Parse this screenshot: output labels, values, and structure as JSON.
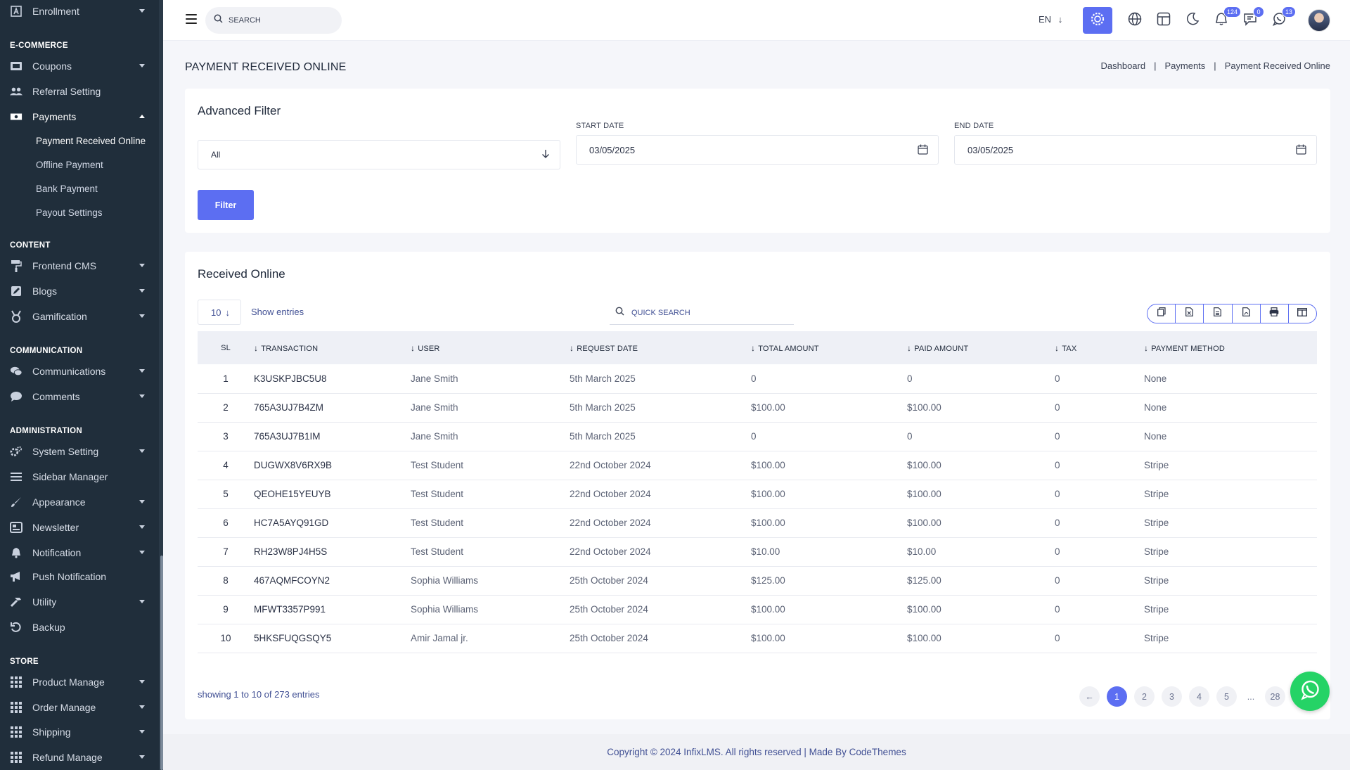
{
  "sidebar": {
    "items": [
      {
        "label": "Enrollment",
        "icon": "enrollment-icon"
      },
      {
        "label": "Coupons",
        "icon": "coupon-icon"
      },
      {
        "label": "Referral Setting",
        "icon": "users-icon"
      },
      {
        "label": "Payments",
        "icon": "money-icon"
      },
      {
        "label": "Frontend CMS",
        "icon": "paint-roller-icon"
      },
      {
        "label": "Blogs",
        "icon": "edit-icon"
      },
      {
        "label": "Gamification",
        "icon": "medal-icon"
      },
      {
        "label": "Communications",
        "icon": "chat-icon"
      },
      {
        "label": "Comments",
        "icon": "comment-icon"
      },
      {
        "label": "System Setting",
        "icon": "gears-icon"
      },
      {
        "label": "Sidebar Manager",
        "icon": "bars-icon"
      },
      {
        "label": "Appearance",
        "icon": "brush-icon"
      },
      {
        "label": "Newsletter",
        "icon": "newsletter-icon"
      },
      {
        "label": "Notification",
        "icon": "bell-icon"
      },
      {
        "label": "Push Notification",
        "icon": "megaphone-icon"
      },
      {
        "label": "Utility",
        "icon": "hammer-icon"
      },
      {
        "label": "Backup",
        "icon": "undo-icon"
      },
      {
        "label": "Product Manage",
        "icon": "grid-icon"
      },
      {
        "label": "Order Manage",
        "icon": "grid-icon"
      },
      {
        "label": "Shipping",
        "icon": "grid-icon"
      },
      {
        "label": "Refund Manage",
        "icon": "grid-icon"
      }
    ],
    "sections": [
      "E-COMMERCE",
      "CONTENT",
      "COMMUNICATION",
      "ADMINISTRATION",
      "STORE"
    ],
    "payments_sub": [
      "Payment Received Online",
      "Offline Payment",
      "Bank Payment",
      "Payout Settings"
    ]
  },
  "header": {
    "search_placeholder": "SEARCH",
    "lang": "EN",
    "badges": {
      "notifications": "124",
      "messages": "0",
      "whatsapp": "13"
    }
  },
  "page": {
    "title": "PAYMENT RECEIVED ONLINE",
    "breadcrumb": [
      "Dashboard",
      "Payments",
      "Payment Received Online"
    ]
  },
  "filter": {
    "title": "Advanced Filter",
    "select_value": "All",
    "start_label": "START DATE",
    "start_value": "03/05/2025",
    "end_label": "END DATE",
    "end_value": "03/05/2025",
    "button": "Filter"
  },
  "list": {
    "title": "Received Online",
    "entries": "10",
    "entries_label": "Show entries",
    "quick_search_placeholder": "QUICK SEARCH",
    "columns": [
      "SL",
      "TRANSACTION",
      "USER",
      "REQUEST DATE",
      "TOTAL AMOUNT",
      "PAID AMOUNT",
      "TAX",
      "PAYMENT METHOD"
    ],
    "rows": [
      [
        "1",
        "K3USKPJBC5U8",
        "Jane Smith",
        "5th March 2025",
        "0",
        "0",
        "0",
        "None"
      ],
      [
        "2",
        "765A3UJ7B4ZM",
        "Jane Smith",
        "5th March 2025",
        "$100.00",
        "$100.00",
        "0",
        "None"
      ],
      [
        "3",
        "765A3UJ7B1IM",
        "Jane Smith",
        "5th March 2025",
        "0",
        "0",
        "0",
        "None"
      ],
      [
        "4",
        "DUGWX8V6RX9B",
        "Test Student",
        "22nd October 2024",
        "$100.00",
        "$100.00",
        "0",
        "Stripe"
      ],
      [
        "5",
        "QEOHE15YEUYB",
        "Test Student",
        "22nd October 2024",
        "$100.00",
        "$100.00",
        "0",
        "Stripe"
      ],
      [
        "6",
        "HC7A5AYQ91GD",
        "Test Student",
        "22nd October 2024",
        "$100.00",
        "$100.00",
        "0",
        "Stripe"
      ],
      [
        "7",
        "RH23W8PJ4H5S",
        "Test Student",
        "22nd October 2024",
        "$10.00",
        "$10.00",
        "0",
        "Stripe"
      ],
      [
        "8",
        "467AQMFCOYN2",
        "Sophia Williams",
        "25th October 2024",
        "$125.00",
        "$125.00",
        "0",
        "Stripe"
      ],
      [
        "9",
        "MFWT3357P991",
        "Sophia Williams",
        "25th October 2024",
        "$100.00",
        "$100.00",
        "0",
        "Stripe"
      ],
      [
        "10",
        "5HKSFUQGSQY5",
        "Amir Jamal jr.",
        "25th October 2024",
        "$100.00",
        "$100.00",
        "0",
        "Stripe"
      ]
    ],
    "showing": "showing 1 to 10 of 273 entries",
    "pages": [
      "1",
      "2",
      "3",
      "4",
      "5",
      "...",
      "28"
    ]
  },
  "footer": {
    "text": "Copyright © 2024 InfixLMS. All rights reserved | Made By CodeThemes"
  },
  "colors": {
    "sidebar_bg": "#202e3b",
    "accent": "#5c6ef2",
    "whatsapp": "#25d366"
  }
}
